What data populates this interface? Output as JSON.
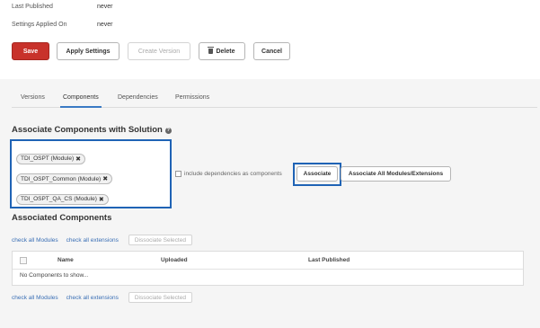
{
  "meta": {
    "last_published_label": "Last Published",
    "last_published_value": "never",
    "settings_applied_label": "Settings Applied On",
    "settings_applied_value": "never"
  },
  "toolbar": {
    "save_label": "Save",
    "apply_settings_label": "Apply Settings",
    "create_version_label": "Create Version",
    "delete_label": "Delete",
    "cancel_label": "Cancel"
  },
  "tabs": [
    {
      "label": "Versions"
    },
    {
      "label": "Components"
    },
    {
      "label": "Dependencies"
    },
    {
      "label": "Permissions"
    }
  ],
  "active_tab": "Components",
  "associate": {
    "title": "Associate Components with Solution",
    "help_icon": "?",
    "selected_components": [
      {
        "label": "TDI_OSPT (Module)"
      },
      {
        "label": "TDI_OSPT_Common (Module)"
      },
      {
        "label": "TDI_OSPT_QA_CS (Module)"
      }
    ],
    "remove_glyph": "✖",
    "include_dependencies_label": "include dependencies as components",
    "associate_button": "Associate",
    "associate_all_button": "Associate All Modules/Extensions"
  },
  "associated": {
    "title": "Associated Components",
    "check_all_modules": "check all Modules",
    "check_all_extensions": "check all extensions",
    "dissociate_selected": "Dissociate Selected",
    "columns": [
      "Name",
      "Uploaded",
      "Last Published"
    ],
    "empty_message": "No Components to show..."
  },
  "colors": {
    "save_button": "#c8322b",
    "highlight": "#1f63b5",
    "link": "#3a6fb5",
    "active_tab_underline": "#3a7ac4"
  }
}
